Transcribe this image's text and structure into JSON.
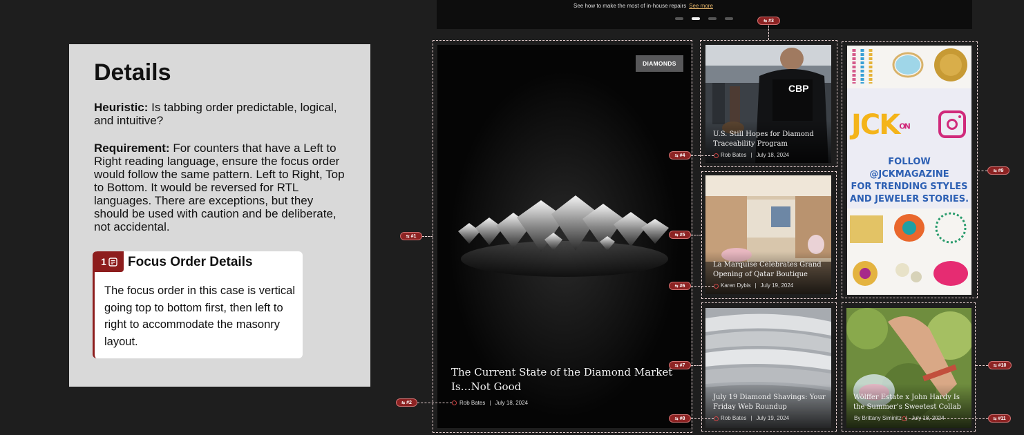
{
  "details": {
    "title": "Details",
    "heuristic_label": "Heuristic:",
    "heuristic_text": "Is tabbing order predictable, logical, and intuitive?",
    "requirement_label": "Requirement:",
    "requirement_text": "For counters that have a Left to Right reading language, ensure the focus order would follow the same pattern. Left to Right, Top to Bottom. It would be reversed for RTL languages. There are exceptions, but they should be used with caution and be deliberate, not accidental.",
    "focus_card": {
      "badge_number": "1",
      "title": "Focus Order Details",
      "body": "The focus order in this case is vertical going top to bottom first, then left to right to accommodate the masonry layout."
    }
  },
  "carousel": {
    "caption": "See how to make the most of in-house repairs",
    "link": "See more"
  },
  "articles": {
    "main": {
      "tag": "DIAMONDS",
      "title": "The Current State of the Diamond Market Is…Not Good",
      "author": "Rob Bates",
      "date": "July 18, 2024"
    },
    "cbp": {
      "title": "U.S. Still Hopes for Diamond Traceability Program",
      "author": "Rob Bates",
      "date": "July 18, 2024",
      "vest_text": "CBP"
    },
    "marquise": {
      "title": "La Marquise Celebrates Grand Opening of Qatar Boutique",
      "author": "Karen Dybis",
      "date": "July 19, 2024"
    },
    "shavings": {
      "title": "July 19 Diamond Shavings: Your Friday Web Roundup",
      "author": "Rob Bates",
      "date": "July 19, 2024"
    },
    "wolffer": {
      "title": "Wölffer Estate x John Hardy Is the Summer’s Sweetest Collab",
      "author": "By Brittany Siminitz",
      "date": "July 18, 2024"
    }
  },
  "ad": {
    "logo_jck": "JCK",
    "logo_on": "ON",
    "text_line1": "FOLLOW @JCKMAGAZINE",
    "text_line2": "FOR TRENDING STYLES",
    "text_line3": "AND JEWELER STORIES."
  },
  "markers": {
    "m1": "#1",
    "m2": "#2",
    "m3": "#3",
    "m4": "#4",
    "m5": "#5",
    "m6": "#6",
    "m7": "#7",
    "m8": "#8",
    "m9": "#9",
    "m10": "#10",
    "m11": "#11"
  },
  "colors": {
    "accent": "#8d1d1d",
    "panel_bg": "#d9d9d9",
    "page_bg": "#1e1e1e",
    "focus_outline": "#e9d2d2",
    "ad_blue": "#2c5fb3"
  }
}
